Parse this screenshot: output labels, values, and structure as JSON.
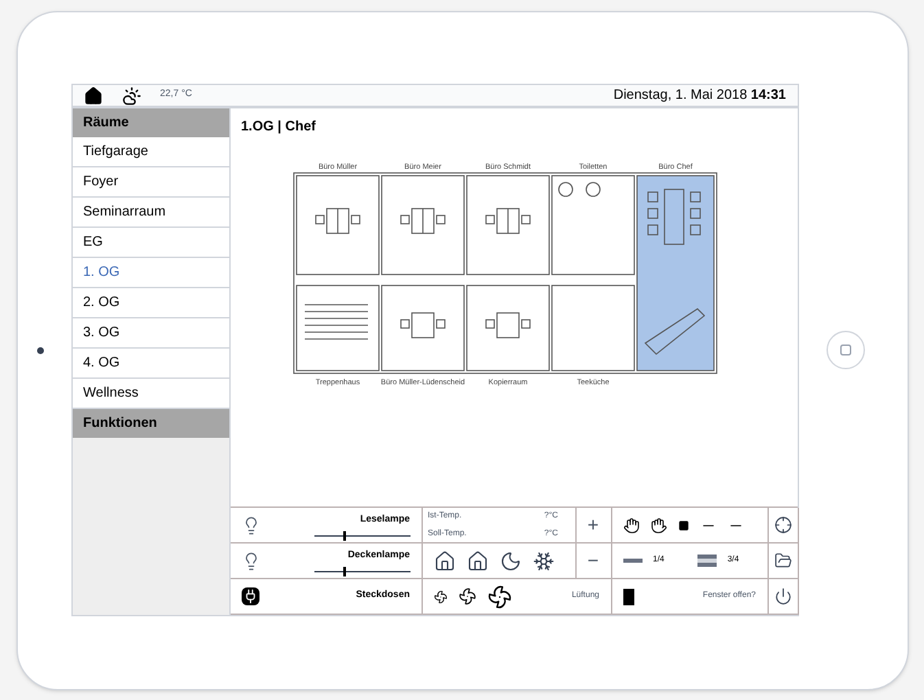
{
  "header": {
    "temperature": "22,7 °C",
    "date": "Dienstag, 1. Mai 2018 **14:31**"
  },
  "sidebar": {
    "rooms_title": "Räume",
    "functions_title": "Funktionen",
    "items": [
      {
        "label": "Tiefgarage",
        "selected": false
      },
      {
        "label": "Foyer",
        "selected": false
      },
      {
        "label": "Seminarraum",
        "selected": false
      },
      {
        "label": "EG",
        "selected": false
      },
      {
        "label": "1. OG",
        "selected": true
      },
      {
        "label": "2. OG",
        "selected": false
      },
      {
        "label": "3. OG",
        "selected": false
      },
      {
        "label": "4. OG",
        "selected": false
      },
      {
        "label": "Wellness",
        "selected": false
      }
    ]
  },
  "breadcrumb": "1.OG | Chef",
  "floor_plan": {
    "top_rooms": [
      {
        "label": "Büro Müller",
        "selected": false
      },
      {
        "label": "Büro Meier",
        "selected": false
      },
      {
        "label": "Büro Schmidt",
        "selected": false
      },
      {
        "label": "Toiletten",
        "selected": false
      },
      {
        "label": "Büro Chef",
        "selected": true
      }
    ],
    "bottom_rooms": [
      {
        "label": "Treppenhaus",
        "selected": false
      },
      {
        "label": "Büro Müller-Lüdenscheid",
        "selected": false
      },
      {
        "label": "Kopierraum",
        "selected": false
      },
      {
        "label": "Teeküche",
        "selected": false
      }
    ]
  },
  "controls": {
    "lamps": [
      {
        "label": "Leselampe",
        "level": 0.3
      },
      {
        "label": "Deckenlampe",
        "level": 0.3
      }
    ],
    "socket_label": "Steckdosen",
    "temperatures": [
      {
        "label": "Ist-Temp.",
        "value": "?°C"
      },
      {
        "label": "Soll-Temp.",
        "value": "?°C"
      }
    ],
    "plus": "+",
    "minus": "−",
    "shade_levels": [
      "1/4",
      "3/4"
    ],
    "ventilation_label": "Lüftung",
    "window_label": "Fenster offen?"
  }
}
